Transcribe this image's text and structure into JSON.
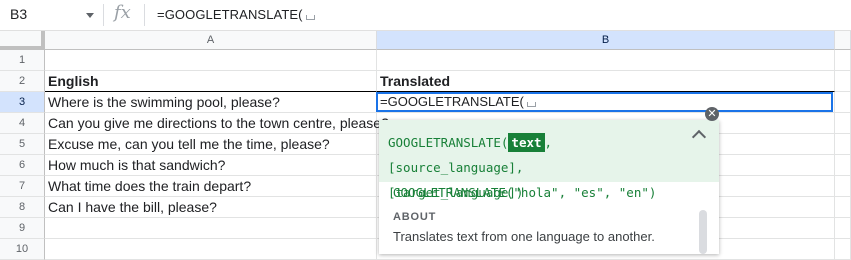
{
  "formula_bar": {
    "cell_ref": "B3",
    "fx_label": "fx",
    "formula": "=GOOGLETRANSLATE("
  },
  "columns": [
    "A",
    "B"
  ],
  "rows": [
    {
      "num": "1",
      "a": "",
      "b": ""
    },
    {
      "num": "2",
      "a": "English",
      "b": "Translated"
    },
    {
      "num": "3",
      "a": "Where is the swimming pool, please?",
      "b": "=GOOGLETRANSLATE("
    },
    {
      "num": "4",
      "a": "Can you give me directions to the town centre, please?",
      "b": ""
    },
    {
      "num": "5",
      "a": "Excuse me, can you tell me the time, please?",
      "b": ""
    },
    {
      "num": "6",
      "a": "How much is that sandwich?",
      "b": ""
    },
    {
      "num": "7",
      "a": "What time does the train depart?",
      "b": ""
    },
    {
      "num": "8",
      "a": "Can I have the bill, please?",
      "b": ""
    },
    {
      "num": "9",
      "a": "",
      "b": ""
    },
    {
      "num": "10",
      "a": "",
      "b": ""
    }
  ],
  "active_cell": {
    "ref": "B3",
    "value": "=GOOGLETRANSLATE("
  },
  "popup": {
    "close_icon": "close-icon",
    "function_name": "GOOGLETRANSLATE(",
    "highlight_param": "text",
    "rest_params_line1": ", [source_language],",
    "rest_params_line2": "[target_language])",
    "example": "GOOGLETRANSLATE(\"hola\", \"es\", \"en\")",
    "about_heading": "ABOUT",
    "about_text": "Translates text from one language to another."
  },
  "colors": {
    "selection_blue": "#1a73e8",
    "header_highlight": "#d3e3fd",
    "popup_green": "#e6f4ea",
    "formula_green": "#188038"
  }
}
